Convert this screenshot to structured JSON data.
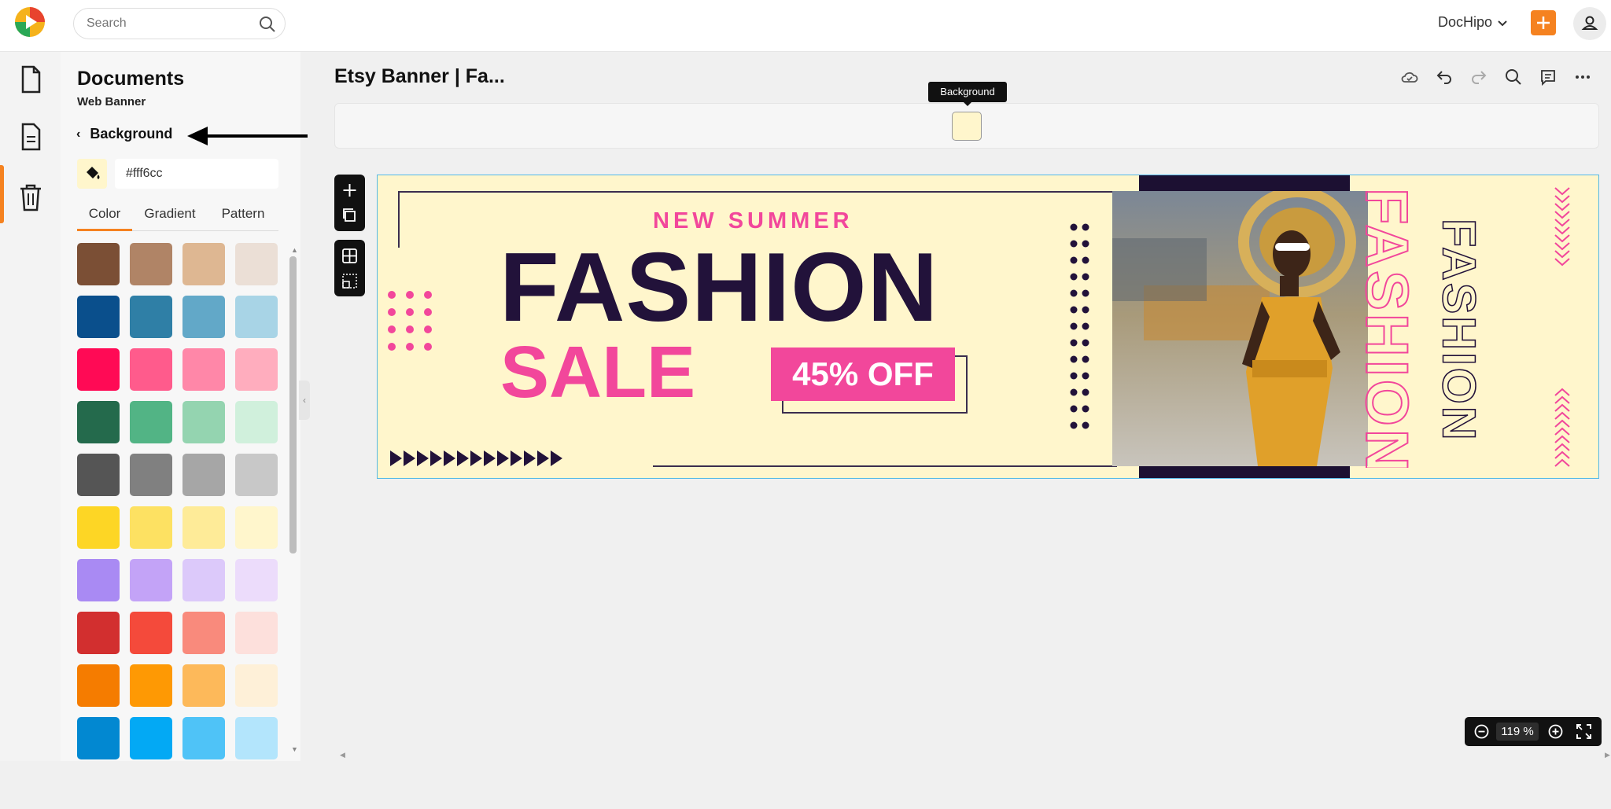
{
  "topbar": {
    "search_placeholder": "Search",
    "account_label": "DocHipo"
  },
  "panel": {
    "title": "Documents",
    "subtitle": "Web Banner",
    "back_label": "Background",
    "hex_value": "#fff6cc",
    "tabs": [
      "Color",
      "Gradient",
      "Pattern"
    ],
    "active_tab": "Color",
    "swatches": [
      [
        "#7b4f35",
        "#b08466",
        "#deb792",
        "#ebdfd6"
      ],
      [
        "#0a4f8c",
        "#2f7fa6",
        "#62a8c8",
        "#a8d4e6"
      ],
      [
        "#ff0a55",
        "#ff5b8c",
        "#ff87a8",
        "#ffadbe"
      ],
      [
        "#246a4c",
        "#52b485",
        "#94d4b0",
        "#d0f0dc"
      ],
      [
        "#555555",
        "#808080",
        "#a6a6a6",
        "#c8c8c8"
      ],
      [
        "#fdd625",
        "#fde162",
        "#feeb98",
        "#fff6cc"
      ],
      [
        "#a98af3",
        "#c3a3f7",
        "#dcc9fa",
        "#ecdcfb"
      ],
      [
        "#d22f2f",
        "#f44a3b",
        "#f98a7c",
        "#fde0dc"
      ],
      [
        "#f57c00",
        "#fe9904",
        "#fdb95a",
        "#fef0d8"
      ],
      [
        "#0288d1",
        "#03a9f4",
        "#4fc3f7",
        "#b3e5fc"
      ]
    ]
  },
  "editor": {
    "doc_title": "Etsy Banner | Fa...",
    "tooltip": "Background",
    "background_color": "#fff6cc",
    "zoom": "119 %"
  },
  "banner": {
    "kicker": "NEW SUMMER",
    "headline": "FASHION",
    "subheadline": "SALE",
    "badge": "45% OFF",
    "vertical_outline_pink": "FASHION",
    "vertical_outline_dark": "FASHION",
    "accent_pink": "#f2479b",
    "accent_dark": "#22123a"
  },
  "icons": {
    "app": "dochipo-logo",
    "search": "search-icon",
    "rail": [
      "document-icon",
      "page-icon",
      "trash-icon"
    ],
    "toolbar": [
      "cloud-save-icon",
      "undo-icon",
      "redo-icon",
      "search-icon",
      "comment-icon",
      "more-icon"
    ],
    "float": [
      "add-icon",
      "duplicate-icon",
      "grid-icon",
      "select-icon"
    ]
  }
}
